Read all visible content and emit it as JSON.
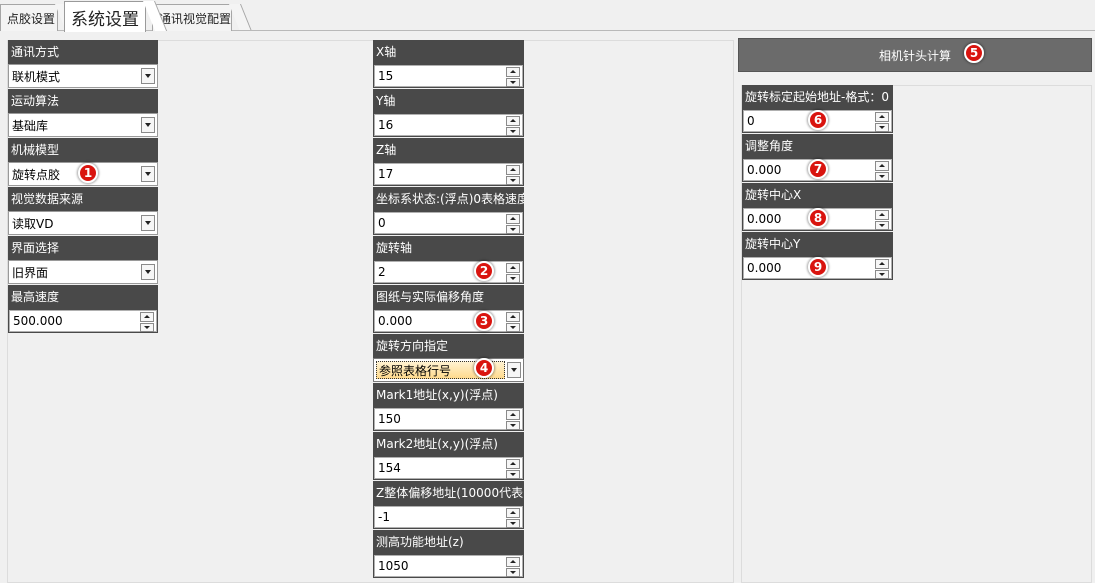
{
  "tabs": [
    {
      "label": "点胶设置"
    },
    {
      "label": "系统设置"
    },
    {
      "label": "通讯视觉配置"
    }
  ],
  "left_column": [
    {
      "label": "通讯方式",
      "value": "联机模式",
      "kind": "dropdown"
    },
    {
      "label": "运动算法",
      "value": "基础库",
      "kind": "dropdown"
    },
    {
      "label": "机械模型",
      "value": "旋转点胶",
      "kind": "dropdown",
      "badge": "1"
    },
    {
      "label": "视觉数据来源",
      "value": "读取VD",
      "kind": "dropdown"
    },
    {
      "label": "界面选择",
      "value": "旧界面",
      "kind": "dropdown"
    },
    {
      "label": "最高速度",
      "value": "500.000",
      "kind": "spinner"
    }
  ],
  "middle_column": [
    {
      "label": "X轴",
      "value": "15",
      "kind": "spinner"
    },
    {
      "label": "Y轴",
      "value": "16",
      "kind": "spinner"
    },
    {
      "label": "Z轴",
      "value": "17",
      "kind": "spinner"
    },
    {
      "label": "坐标系状态:(浮点)0表格速度",
      "value": "0",
      "kind": "spinner"
    },
    {
      "label": "旋转轴",
      "value": "2",
      "kind": "spinner",
      "badge": "2"
    },
    {
      "label": "图纸与实际偏移角度",
      "value": "0.000",
      "kind": "spinner",
      "badge": "3"
    },
    {
      "label": "旋转方向指定",
      "value": "参照表格行号",
      "kind": "dropdown",
      "badge": "4"
    },
    {
      "label": "Mark1地址(x,y)(浮点)",
      "value": "150",
      "kind": "spinner"
    },
    {
      "label": "Mark2地址(x,y)(浮点)",
      "value": "154",
      "kind": "spinner"
    },
    {
      "label": "Z整体偏移地址(10000代表",
      "value": "-1",
      "kind": "spinner"
    },
    {
      "label": "测高功能地址(z)",
      "value": "1050",
      "kind": "spinner"
    }
  ],
  "right_panel": {
    "button_label": "相机针头计算",
    "button_badge": "5",
    "fields": [
      {
        "label": "旋转标定起始地址-格式：0",
        "value": "0",
        "kind": "spinner",
        "badge": "6"
      },
      {
        "label": "调整角度",
        "value": "0.000",
        "kind": "spinner",
        "badge": "7"
      },
      {
        "label": "旋转中心X",
        "value": "0.000",
        "kind": "spinner",
        "badge": "8"
      },
      {
        "label": "旋转中心Y",
        "value": "0.000",
        "kind": "spinner",
        "badge": "9"
      }
    ]
  },
  "colors": {
    "label_bg": "#494949",
    "badge": "#d9140f",
    "button_bg": "#6b6b6b"
  }
}
